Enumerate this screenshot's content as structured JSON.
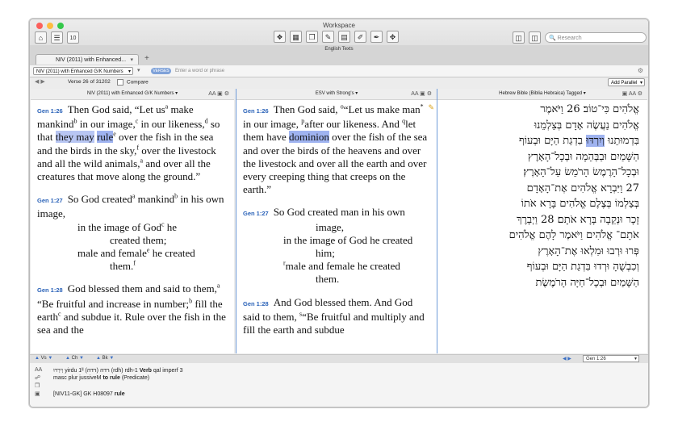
{
  "window": {
    "title": "Workspace",
    "lights": {
      "close": "#fc605c",
      "min": "#fdbc40",
      "max": "#34c84a"
    }
  },
  "toolbar": {
    "left_icons": [
      "home-icon",
      "library-icon",
      "calendar-icon"
    ],
    "calendar_text": "10",
    "center_icons": [
      "bookmark-icon",
      "layout-icon",
      "copy-icon",
      "highlight-icon",
      "note-icon",
      "edit-icon",
      "brush-icon",
      "move-icon"
    ],
    "right_icons": [
      "panels-icon",
      "split-icon"
    ],
    "search_placeholder": "Research"
  },
  "tabs": {
    "strip_title": "English Texts",
    "active_tab": "NIV (2011) with Enhanced...",
    "add": "+"
  },
  "input_bar": {
    "resource": "NIV (2011) with Enhanced G/K Numbers",
    "pill": "VERSES",
    "placeholder": "Enter a word or phrase"
  },
  "nav_bar": {
    "verse_status": "Verse 26 of 31202",
    "compare": "Compare",
    "add_parallel": "Add Parallel"
  },
  "pane1": {
    "title": "NIV (2011) with Enhanced G/K Numbers",
    "v26": {
      "ref": "Gen 1:26",
      "t1": "Then God said, “Let us",
      "fa": "a",
      "t2": " make mankind",
      "fb": "b",
      "t3": " in our image,",
      "fc": "c",
      "t4": " in our likeness,",
      "fd": "d",
      "t5": " so that ",
      "hl1": "they may",
      "t6": " ",
      "hl2": "rule",
      "fe": "e",
      "t7": " over the fish in the sea and the birds in the sky,",
      "ff": "f",
      "t8": " over the livestock and all the wild animals,",
      "fa2": "a",
      "t9": " and over all the creatures that move along the ground.”"
    },
    "v27": {
      "ref": "Gen 1:27",
      "t1": "So God created",
      "fa": "a",
      "t2": " mankind",
      "fb": "b",
      "t3": " in his own image,",
      "l2a": "in the image of God",
      "fc": "c",
      "l2b": " he",
      "l3": "created them;",
      "l4a": "male and female",
      "fe": "e",
      "l4b": " he created",
      "l5a": "them.",
      "ff": "f"
    },
    "v28": {
      "ref": "Gen 1:28",
      "t1": "God blessed them and said to them,",
      "fa": "a",
      "t2": " “Be fruitful and increase in number;",
      "fb": "b",
      "t3": " fill the earth",
      "fc": "c",
      "t4": " and subdue it. Rule over the fish in the sea and the"
    }
  },
  "pane2": {
    "title": "ESV with Strong's",
    "v26": {
      "ref": "Gen 1:26",
      "t1": "Then God said, ",
      "fo": "o",
      "t2": "“Let us make man",
      "fstar": "*",
      "t3": " in our image, ",
      "fp": "p",
      "t4": "after our likeness. And ",
      "fq": "q",
      "t5": "let them have ",
      "hl": "dominion",
      "t6": " over the fish of the sea and over the birds of the heavens and over the livestock and over all the earth and over every creeping thing that creeps on the earth.”"
    },
    "v27": {
      "ref": "Gen 1:27",
      "t1": "So God created man in his own",
      "l2": "image,",
      "l3": "in the image of God he created",
      "l4": "him;",
      "fr": "r",
      "l5": "male and female he created",
      "l6": "them."
    },
    "v28": {
      "ref": "Gen 1:28",
      "t1": "And God blessed them. And God said to them, ",
      "fs": "s",
      "t2": "“Be fruitful and multiply and fill the earth and subdue"
    }
  },
  "pane3": {
    "title": "Hebrew Bible (Biblia Hebraica) Tagged",
    "lines": [
      "אֱלֹהִים כִּי־טוֹב׃ 26 וַיֹּאמֶר",
      "אֱלֹהִים נַעֲשֶׂה אָדָם בְּצַלְמֵנוּ",
      "בִּדְמוּתֵנוּ וְיִרְדּוּ בִדְגַת הַיָּם וּבְעוֹף",
      "הַשָּׁמַיִם וּבַבְּהֵמָה וּבְכָל־הָאָרֶץ",
      "וּבְכָל־הָרֶמֶשׂ הָרֹמֵשׂ עַל־הָאָרֶץ׃",
      "27 וַיִּבְרָא אֱלֹהִים אֶת־הָאָדָם",
      "בְּצַלְמוֹ בְּצֶלֶם אֱלֹהִים בָּרָא אֹתוֹ",
      "זָכָר וּנְקֵבָה בָּרָא אֹתָם׃ 28 וַיְבָרֶךְ",
      "אֹתָם־ אֱלֹהִים וַיֹּאמֶר לָהֶם אֱלֹהִים",
      "פְּרוּ וּרְבוּ וּמִלְאוּ אֶת־הָאָרֶץ",
      "וְכִבְשֻׁהָ וּרְדוּ בִּדְגַת הַיָּם וּבְעוֹף",
      "הַשָּׁמַיִם וּבְכָל־חַיָּה הָרֹמֶשֶׂת"
    ],
    "highlight_line": 2,
    "highlight_word": "וְיִרְדּוּ"
  },
  "bottom_bar": {
    "vs": "Vs",
    "ch": "Ch",
    "bk": "Bk",
    "current_ref": "Gen 1:26"
  },
  "info": {
    "line1a": "וְיִרְדּוּ",
    "line1b": "yirdu   1ᴵᴵ רדה (רדה) (rdh) rdh-1",
    "line1c": "Verb",
    "line1d": "qal imperf 3",
    "line2a": "masc plur jussiveM",
    "line2b": "to rule",
    "line2c": "(Predicate)",
    "line3a": "[NIV11-GK] GK H08097",
    "line3b": "rule"
  }
}
